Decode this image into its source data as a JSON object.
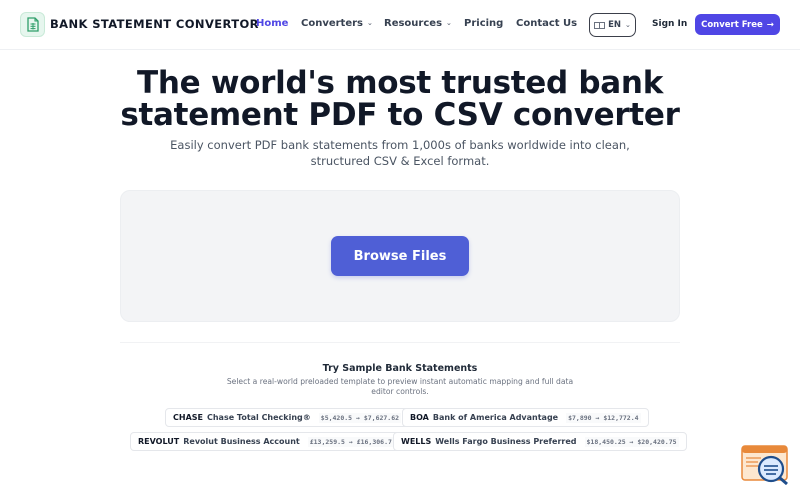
{
  "brand": {
    "name": "BANK STATEMENT CONVERTOR",
    "icon": "spreadsheet-icon",
    "accent": "#4f46e5",
    "logo_bg": "#e6f6ee"
  },
  "nav": {
    "home": "Home",
    "converters": "Converters",
    "resources": "Resources",
    "pricing": "Pricing",
    "contact": "Contact Us",
    "lang": "EN",
    "signin": "Sign In",
    "cta": "Convert Free",
    "cta_arrow": "→"
  },
  "hero": {
    "line1": "The world's most trusted bank",
    "line2": "statement PDF to CSV converter",
    "sub_line1": "Easily convert PDF bank statements from 1,000s of banks worldwide into clean,",
    "sub_line2": "structured CSV & Excel format."
  },
  "upload": {
    "button": "Browse Files",
    "button_color": "#4f5fd6"
  },
  "samples": {
    "title": "Try Sample Bank Statements",
    "sub_line1": "Select a real-world preloaded template to preview instant automatic mapping and full data",
    "sub_line2": "editor controls.",
    "items": [
      {
        "code": "CHASE",
        "name": "Chase Total Checking®",
        "range": "$5,420.5 → $7,627.62"
      },
      {
        "code": "BOA",
        "name": "Bank of America Advantage",
        "range": "$7,890 → $12,772.4"
      },
      {
        "code": "REVOLUT",
        "name": "Revolut Business Account",
        "range": "£13,259.5 → £16,306.7"
      },
      {
        "code": "WELLS",
        "name": "Wells Fargo Business Preferred",
        "range": "$18,450.25 → $20,420.75"
      }
    ]
  },
  "chat": {
    "icon": "chat-support-icon"
  }
}
